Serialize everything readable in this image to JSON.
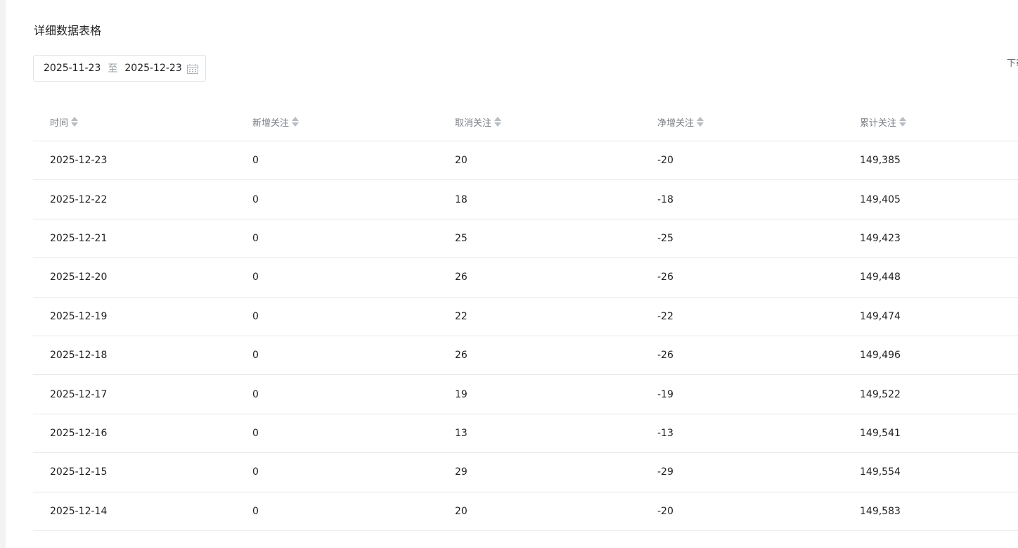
{
  "section": {
    "title": "详细数据表格"
  },
  "date_range": {
    "start": "2025-11-23",
    "separator": "至",
    "end": "2025-12-23"
  },
  "download": {
    "label": "下载"
  },
  "table": {
    "columns": [
      "时间",
      "新增关注",
      "取消关注",
      "净增关注",
      "累计关注"
    ],
    "rows": [
      [
        "2025-12-23",
        "0",
        "20",
        "-20",
        "149,385"
      ],
      [
        "2025-12-22",
        "0",
        "18",
        "-18",
        "149,405"
      ],
      [
        "2025-12-21",
        "0",
        "25",
        "-25",
        "149,423"
      ],
      [
        "2025-12-20",
        "0",
        "26",
        "-26",
        "149,448"
      ],
      [
        "2025-12-19",
        "0",
        "22",
        "-22",
        "149,474"
      ],
      [
        "2025-12-18",
        "0",
        "26",
        "-26",
        "149,496"
      ],
      [
        "2025-12-17",
        "0",
        "19",
        "-19",
        "149,522"
      ],
      [
        "2025-12-16",
        "0",
        "13",
        "-13",
        "149,541"
      ],
      [
        "2025-12-15",
        "0",
        "29",
        "-29",
        "149,554"
      ],
      [
        "2025-12-14",
        "0",
        "20",
        "-20",
        "149,583"
      ]
    ]
  }
}
